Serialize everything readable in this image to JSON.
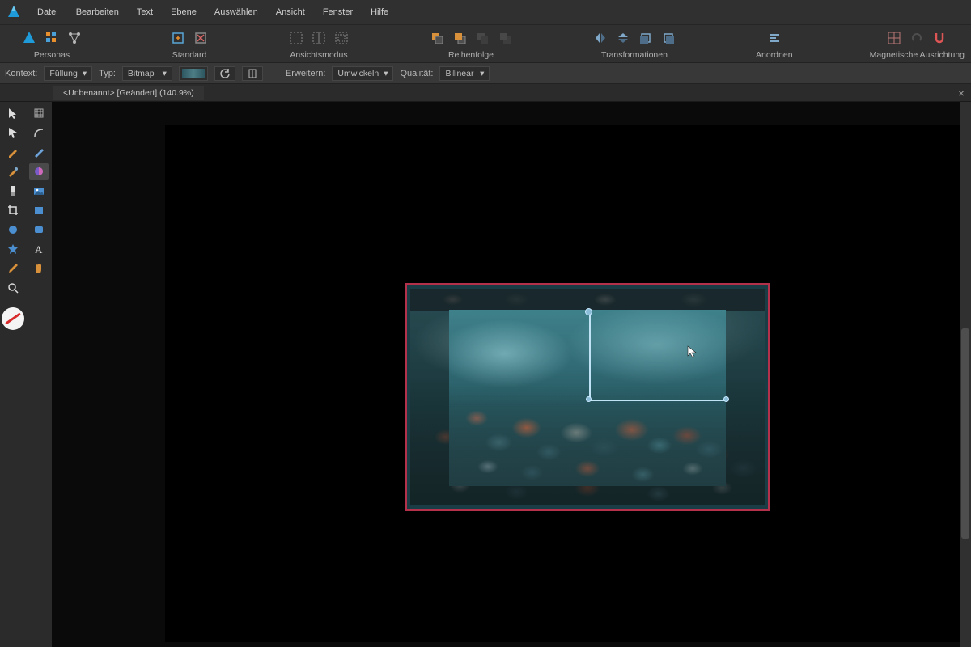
{
  "menubar": {
    "items": [
      "Datei",
      "Bearbeiten",
      "Text",
      "Ebene",
      "Auswählen",
      "Ansicht",
      "Fenster",
      "Hilfe"
    ]
  },
  "ribbon": {
    "personas": {
      "label": "Personas"
    },
    "standard": {
      "label": "Standard"
    },
    "view_mode": {
      "label": "Ansichtsmodus"
    },
    "order": {
      "label": "Reihenfolge"
    },
    "transforms": {
      "label": "Transformationen"
    },
    "arrange": {
      "label": "Anordnen"
    },
    "snap": {
      "label": "Magnetische Ausrichtung"
    }
  },
  "context": {
    "kontext_label": "Kontext:",
    "kontext_value": "Füllung",
    "typ_label": "Typ:",
    "typ_value": "Bitmap",
    "erweitern_label": "Erweitern:",
    "erweitern_value": "Umwickeln",
    "qualitaet_label": "Qualität:",
    "qualitaet_value": "Bilinear"
  },
  "document": {
    "tab_title": "<Unbenannt> [Geändert] (140.9%)"
  },
  "icons": {
    "caret": "▾"
  }
}
